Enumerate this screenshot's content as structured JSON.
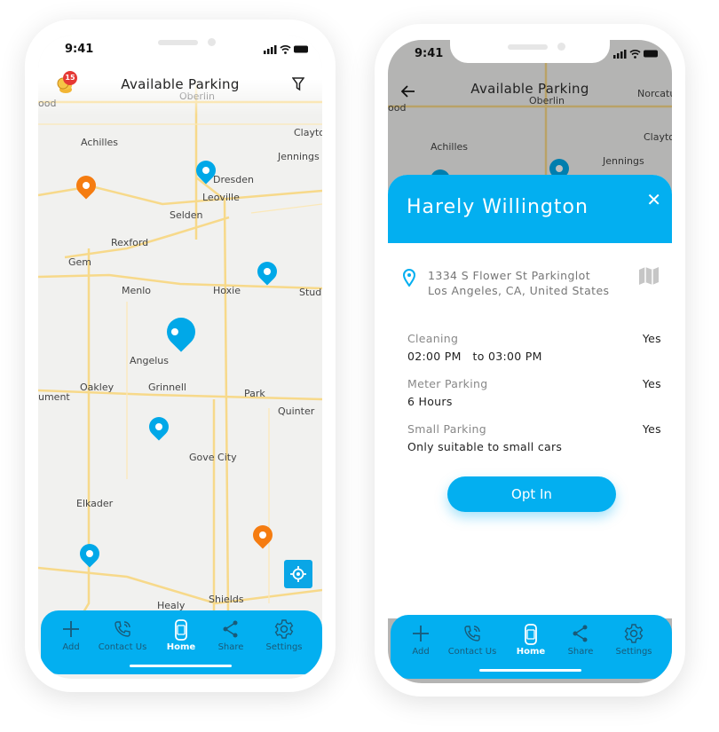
{
  "status": {
    "time": "9:41"
  },
  "header": {
    "title": "Available Parking",
    "badge_count": "15"
  },
  "map_labels": {
    "oberlin": "Oberlin",
    "achilles": "Achilles",
    "jennings": "Jennings",
    "clayton": "Clayto",
    "dresden": "Dresden",
    "leoville": "Leoville",
    "selden": "Selden",
    "rexford": "Rexford",
    "gem": "Gem",
    "menlo": "Menlo",
    "hoxie": "Hoxie",
    "studley": "Studl",
    "angelus": "Angelus",
    "oakley": "Oakley",
    "grinnell": "Grinnell",
    "park": "Park",
    "quinter": "Quinter",
    "monument": "ument",
    "gove": "Gove City",
    "elkader": "Elkader",
    "shields": "Shields",
    "healy": "Healy",
    "wood": "ood",
    "norcatur": "Norcatu"
  },
  "nav": {
    "items": [
      {
        "label": "Add",
        "icon": "plus-icon"
      },
      {
        "label": "Contact Us",
        "icon": "phone-icon"
      },
      {
        "label": "Home",
        "icon": "car-icon",
        "active": true
      },
      {
        "label": "Share",
        "icon": "share-icon"
      },
      {
        "label": "Settings",
        "icon": "gear-icon"
      }
    ]
  },
  "detail": {
    "name": "Harely Willington",
    "address_line1": "1334 S Flower St Parkinglot",
    "address_line2": "Los Angeles, CA, United States",
    "rows": [
      {
        "key": "Cleaning",
        "value": "02:00 PM   to 03:00 PM",
        "flag": "Yes"
      },
      {
        "key": "Meter Parking",
        "value": "6 Hours",
        "flag": "Yes"
      },
      {
        "key": "Small Parking",
        "value": "Only suitable to small cars",
        "flag": "Yes"
      }
    ],
    "button": "Opt In"
  },
  "colors": {
    "accent": "#03aff0",
    "pin_blue": "#00a8e8",
    "pin_orange": "#f57c10"
  }
}
